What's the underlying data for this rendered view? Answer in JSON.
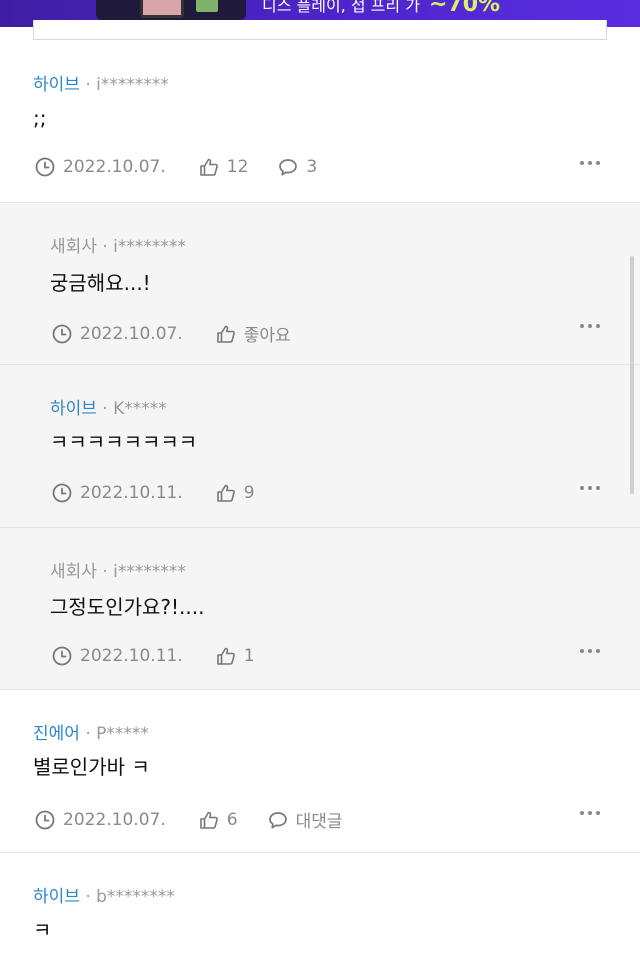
{
  "ad": {
    "text": "디스 플레이, 접 프리 가 ",
    "percent": "~70%"
  },
  "comments": [
    {
      "author": "하이브",
      "sep": "·",
      "uid": "i********",
      "text": ";;",
      "date": "2022.10.07.",
      "likes": "12",
      "replies": "3"
    },
    {
      "author": "새회사",
      "sep": "·",
      "uid": "i********",
      "text": "궁금해요...!",
      "date": "2022.10.07.",
      "likes": "좋아요"
    },
    {
      "author": "하이브",
      "sep": "·",
      "uid": "K*****",
      "text": "ㅋㅋㅋㅋㅋㅋㅋㅋ",
      "date": "2022.10.11.",
      "likes": "9"
    },
    {
      "author": "새회사",
      "sep": "·",
      "uid": "i********",
      "text": "그정도인가요?!....",
      "date": "2022.10.11.",
      "likes": "1"
    },
    {
      "author": "진에어",
      "sep": "·",
      "uid": "P*****",
      "text": "별로인가바 ㅋ",
      "date": "2022.10.07.",
      "likes": "6",
      "replies": "대댓글"
    },
    {
      "author": "하이브",
      "sep": "·",
      "uid": "b********",
      "text": "ㅋ"
    }
  ]
}
